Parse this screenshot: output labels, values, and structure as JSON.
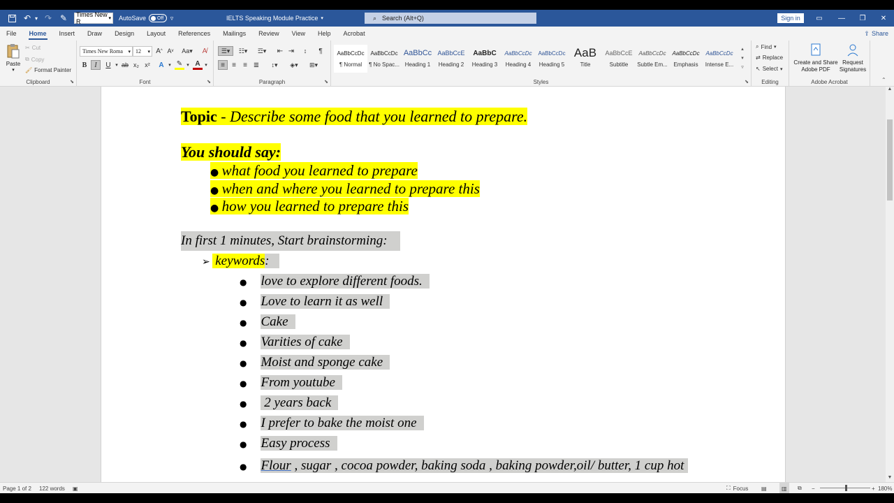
{
  "titlebar": {
    "font_name": "Times New R",
    "autosave_label": "AutoSave",
    "autosave_state": "Off",
    "doc_title": "IELTS Speaking Module Practice",
    "search_placeholder": "Search (Alt+Q)",
    "signin_label": "Sign in"
  },
  "tabs": [
    "File",
    "Home",
    "Insert",
    "Draw",
    "Design",
    "Layout",
    "References",
    "Mailings",
    "Review",
    "View",
    "Help",
    "Acrobat"
  ],
  "share_label": "Share",
  "ribbon": {
    "clipboard": {
      "paste": "Paste",
      "cut": "Cut",
      "copy": "Copy",
      "format_painter": "Format Painter",
      "label": "Clipboard"
    },
    "font": {
      "font_name": "Times New Roma",
      "font_size": "12",
      "label": "Font"
    },
    "paragraph": {
      "label": "Paragraph"
    },
    "styles": {
      "label": "Styles",
      "items": [
        {
          "preview": "AaBbCcDc",
          "name": "¶ Normal"
        },
        {
          "preview": "AaBbCcDc",
          "name": "¶ No Spac..."
        },
        {
          "preview": "AaBbCc",
          "name": "Heading 1"
        },
        {
          "preview": "AaBbCcE",
          "name": "Heading 2"
        },
        {
          "preview": "AaBbC",
          "name": "Heading 3"
        },
        {
          "preview": "AaBbCcDc",
          "name": "Heading 4"
        },
        {
          "preview": "AaBbCcDc",
          "name": "Heading 5"
        },
        {
          "preview": "AaB",
          "name": "Title"
        },
        {
          "preview": "AaBbCcE",
          "name": "Subtitle"
        },
        {
          "preview": "AaBbCcDc",
          "name": "Subtle Em..."
        },
        {
          "preview": "AaBbCcDc",
          "name": "Emphasis"
        },
        {
          "preview": "AaBbCcDc",
          "name": "Intense E..."
        }
      ]
    },
    "editing": {
      "find": "Find",
      "replace": "Replace",
      "select": "Select",
      "label": "Editing"
    },
    "acrobat": {
      "create_share": "Create and Share Adobe PDF",
      "request_sig": "Request Signatures",
      "label": "Adobe Acrobat"
    }
  },
  "document": {
    "topic_label": "Topic",
    "topic_text": " - Describe some food that you learned to prepare.",
    "should_say": "You should say:",
    "say_bullets": [
      "what food you learned to prepare",
      "when and where you learned to prepare this",
      "how you learned to prepare this"
    ],
    "brainstorm": "In first 1 minutes, Start brainstorming:",
    "keywords_label": "keywords",
    "keywords_colon": ":",
    "keywords": [
      "love to explore different foods.",
      "Love to learn it as well",
      "Cake",
      "Varities of cake",
      "Moist and sponge cake",
      "From youtube",
      " 2 years back",
      "I prefer to bake the moist one",
      "Easy process"
    ],
    "last_keyword_first": "Flour",
    "last_keyword_rest": " , sugar , cocoa powder, baking soda , baking powder,oil/ butter, 1 cup hot"
  },
  "statusbar": {
    "page": "Page 1 of 2",
    "words": "122 words",
    "focus": "Focus",
    "zoom": "180%"
  }
}
